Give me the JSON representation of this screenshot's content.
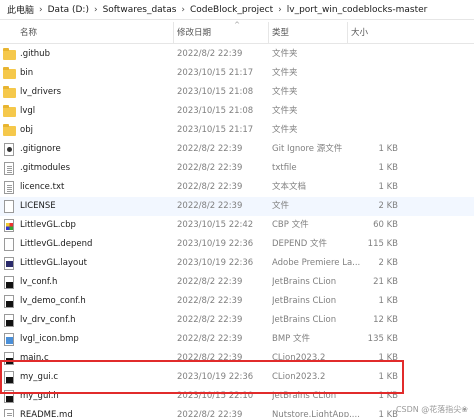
{
  "breadcrumb": [
    "此电脑",
    "Data (D:)",
    "Softwares_datas",
    "CodeBlock_project",
    "lv_port_win_codeblocks-master"
  ],
  "columns": {
    "name": "名称",
    "date": "修改日期",
    "type": "类型",
    "size": "大小"
  },
  "files": [
    {
      "name": ".github",
      "date": "2022/8/2 22:39",
      "type": "文件夹",
      "size": "",
      "icon": "folder-icon"
    },
    {
      "name": "bin",
      "date": "2023/10/15 21:17",
      "type": "文件夹",
      "size": "",
      "icon": "folder-icon"
    },
    {
      "name": "lv_drivers",
      "date": "2023/10/15 21:08",
      "type": "文件夹",
      "size": "",
      "icon": "folder-icon"
    },
    {
      "name": "lvgl",
      "date": "2023/10/15 21:08",
      "type": "文件夹",
      "size": "",
      "icon": "folder-icon"
    },
    {
      "name": "obj",
      "date": "2023/10/15 21:17",
      "type": "文件夹",
      "size": "",
      "icon": "folder-icon"
    },
    {
      "name": ".gitignore",
      "date": "2022/8/2 22:39",
      "type": "Git Ignore 源文件",
      "size": "1 KB",
      "icon": "git-file-icon"
    },
    {
      "name": ".gitmodules",
      "date": "2022/8/2 22:39",
      "type": "txtfile",
      "size": "1 KB",
      "icon": "text-file-icon"
    },
    {
      "name": "licence.txt",
      "date": "2022/8/2 22:39",
      "type": "文本文档",
      "size": "1 KB",
      "icon": "text-file-icon"
    },
    {
      "name": "LICENSE",
      "date": "2022/8/2 22:39",
      "type": "文件",
      "size": "2 KB",
      "icon": "blank-file-icon"
    },
    {
      "name": "LittlevGL.cbp",
      "date": "2023/10/15 22:42",
      "type": "CBP 文件",
      "size": "60 KB",
      "icon": "codeblocks-file-icon"
    },
    {
      "name": "LittlevGL.depend",
      "date": "2023/10/19 22:36",
      "type": "DEPEND 文件",
      "size": "115 KB",
      "icon": "blank-file-icon"
    },
    {
      "name": "LittlevGL.layout",
      "date": "2023/10/19 22:36",
      "type": "Adobe Premiere La...",
      "size": "2 KB",
      "icon": "premiere-file-icon"
    },
    {
      "name": "lv_conf.h",
      "date": "2022/8/2 22:39",
      "type": "JetBrains CLion",
      "size": "21 KB",
      "icon": "clion-file-icon"
    },
    {
      "name": "lv_demo_conf.h",
      "date": "2022/8/2 22:39",
      "type": "JetBrains CLion",
      "size": "1 KB",
      "icon": "clion-file-icon"
    },
    {
      "name": "lv_drv_conf.h",
      "date": "2022/8/2 22:39",
      "type": "JetBrains CLion",
      "size": "12 KB",
      "icon": "clion-file-icon"
    },
    {
      "name": "lvgl_icon.bmp",
      "date": "2022/8/2 22:39",
      "type": "BMP 文件",
      "size": "135 KB",
      "icon": "bitmap-file-icon"
    },
    {
      "name": "main.c",
      "date": "2022/8/2 22:39",
      "type": "CLion2023.2",
      "size": "1 KB",
      "icon": "clion-file-icon"
    },
    {
      "name": "my_gui.c",
      "date": "2023/10/19 22:36",
      "type": "CLion2023.2",
      "size": "1 KB",
      "icon": "clion-file-icon"
    },
    {
      "name": "my_gui.h",
      "date": "2023/10/15 22:10",
      "type": "JetBrains CLion",
      "size": "1 KB",
      "icon": "clion-file-icon"
    },
    {
      "name": "README.md",
      "date": "2022/8/2 22:39",
      "type": "Nutstore.LightApp....",
      "size": "1 KB",
      "icon": "text-file-icon"
    }
  ],
  "highlighted_row": "LICENSE",
  "watermark": "CSDN @花落指尖❀",
  "colors": {
    "highlight_box": "#e12b2b",
    "folder": "#f5c84b",
    "selected_row": "#f2f7ff"
  }
}
